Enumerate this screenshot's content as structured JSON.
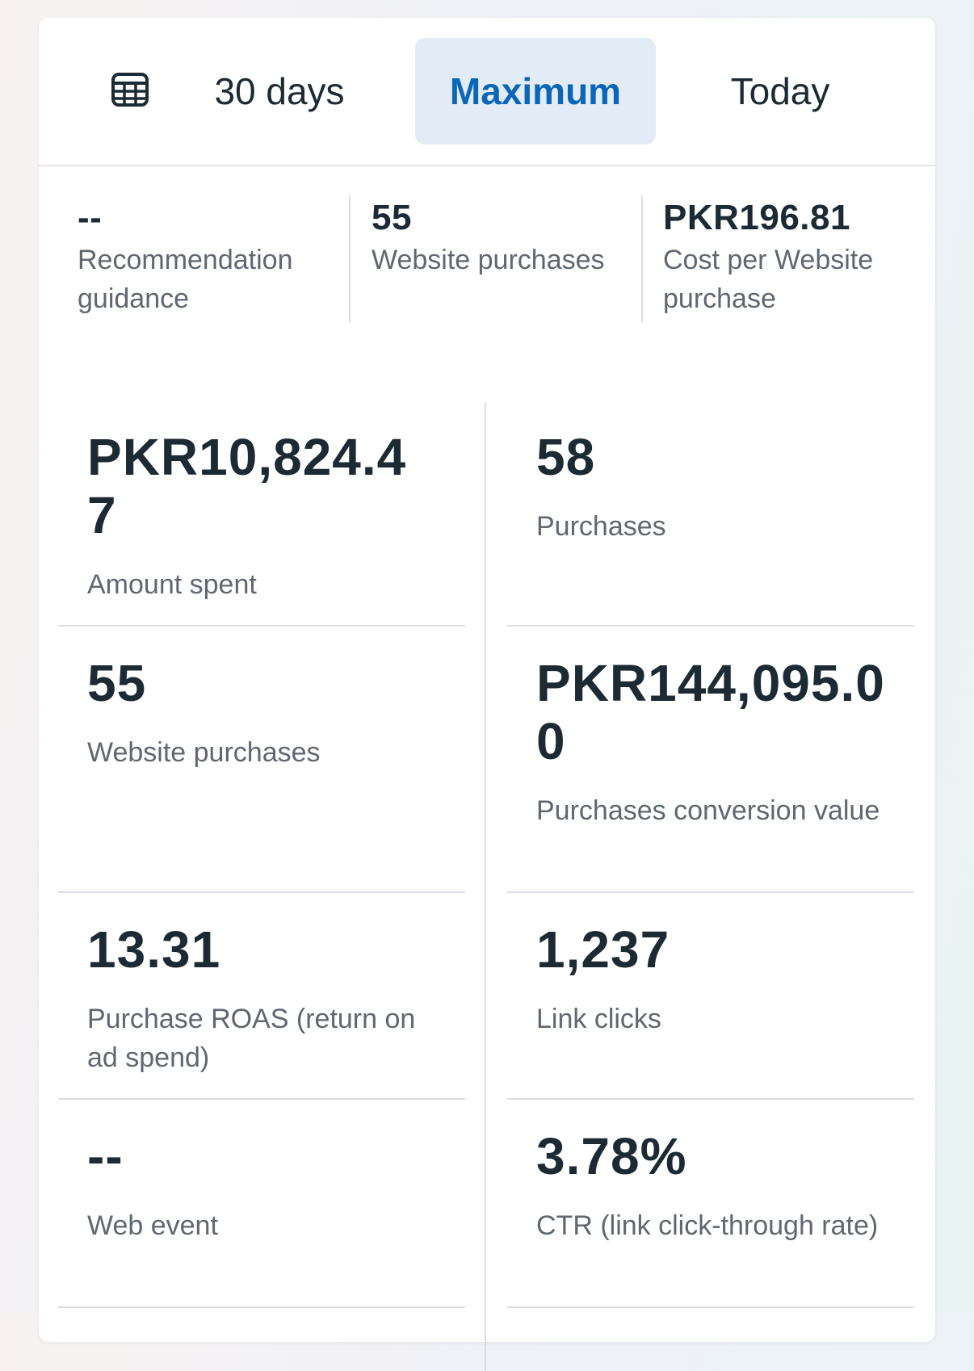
{
  "tabs": {
    "thirty_days": "30 days",
    "maximum": "Maximum",
    "today": "Today",
    "active": "Maximum",
    "calendar_icon": "calendar-icon"
  },
  "summary": [
    {
      "value": "--",
      "label": "Recommendation guidance"
    },
    {
      "value": "55",
      "label": "Website purchases"
    },
    {
      "value": "PKR196.81",
      "label": "Cost per Website purchase"
    }
  ],
  "metrics": {
    "amount_spent": {
      "value": "PKR10,824.47",
      "label": "Amount spent"
    },
    "purchases": {
      "value": "58",
      "label": "Purchases"
    },
    "website_purchases": {
      "value": "55",
      "label": "Website purchases"
    },
    "conversion_value": {
      "value": "PKR144,095.00",
      "label": "Purchases conversion value"
    },
    "roas": {
      "value": "13.31",
      "label": "Purchase ROAS (return on ad spend)"
    },
    "link_clicks": {
      "value": "1,237",
      "label": "Link clicks"
    },
    "web_event": {
      "value": "--",
      "label": "Web event"
    },
    "ctr": {
      "value": "3.78%",
      "label": "CTR (link click-through rate)"
    }
  },
  "colors": {
    "accent": "#0a66b8",
    "active_tab_bg": "#e3ecf6",
    "text_primary": "#1c2b33",
    "text_secondary": "#606770",
    "divider": "#dadde1"
  }
}
